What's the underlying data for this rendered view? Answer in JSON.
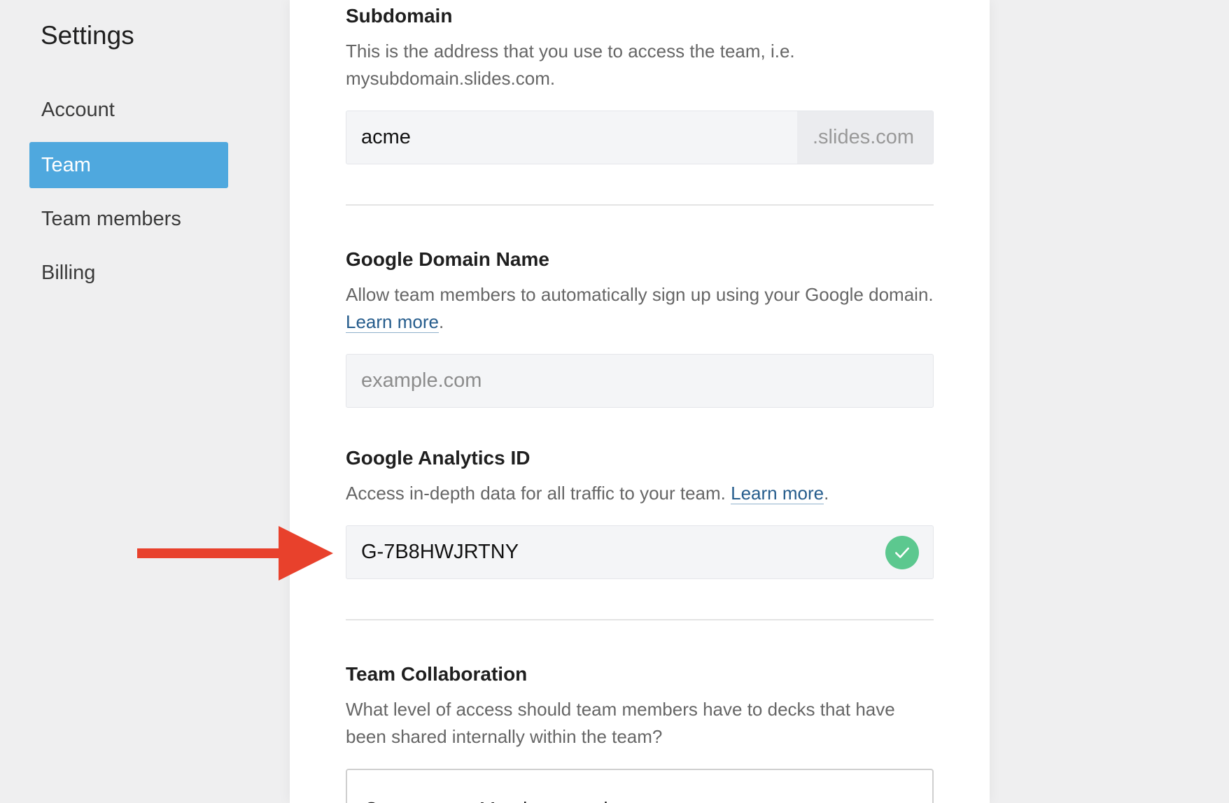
{
  "sidebar": {
    "title": "Settings",
    "items": [
      {
        "label": "Account",
        "active": false
      },
      {
        "label": "Team",
        "active": true
      },
      {
        "label": "Team members",
        "active": false
      },
      {
        "label": "Billing",
        "active": false
      }
    ]
  },
  "subdomain": {
    "title": "Subdomain",
    "description": "This is the address that you use to access the team, i.e. mysubdomain.slides.com.",
    "value": "acme",
    "suffix": ".slides.com"
  },
  "google_domain": {
    "title": "Google Domain Name",
    "description": "Allow team members to automatically sign up using your Google domain.",
    "link": "Learn more",
    "placeholder": "example.com",
    "value": ""
  },
  "analytics": {
    "title": "Google Analytics ID",
    "description": "Access in-depth data for all traffic to your team.",
    "link": "Learn more",
    "value": "G-7B8HWJRTNY"
  },
  "collaboration": {
    "title": "Team Collaboration",
    "description": "What level of access should team members have to decks that have been shared internally within the team?",
    "selected": "Comment — Members can leave comments"
  },
  "colors": {
    "accent": "#4fa8de",
    "link": "#255c8c",
    "success": "#5cc88f",
    "arrow": "#e8412c"
  }
}
